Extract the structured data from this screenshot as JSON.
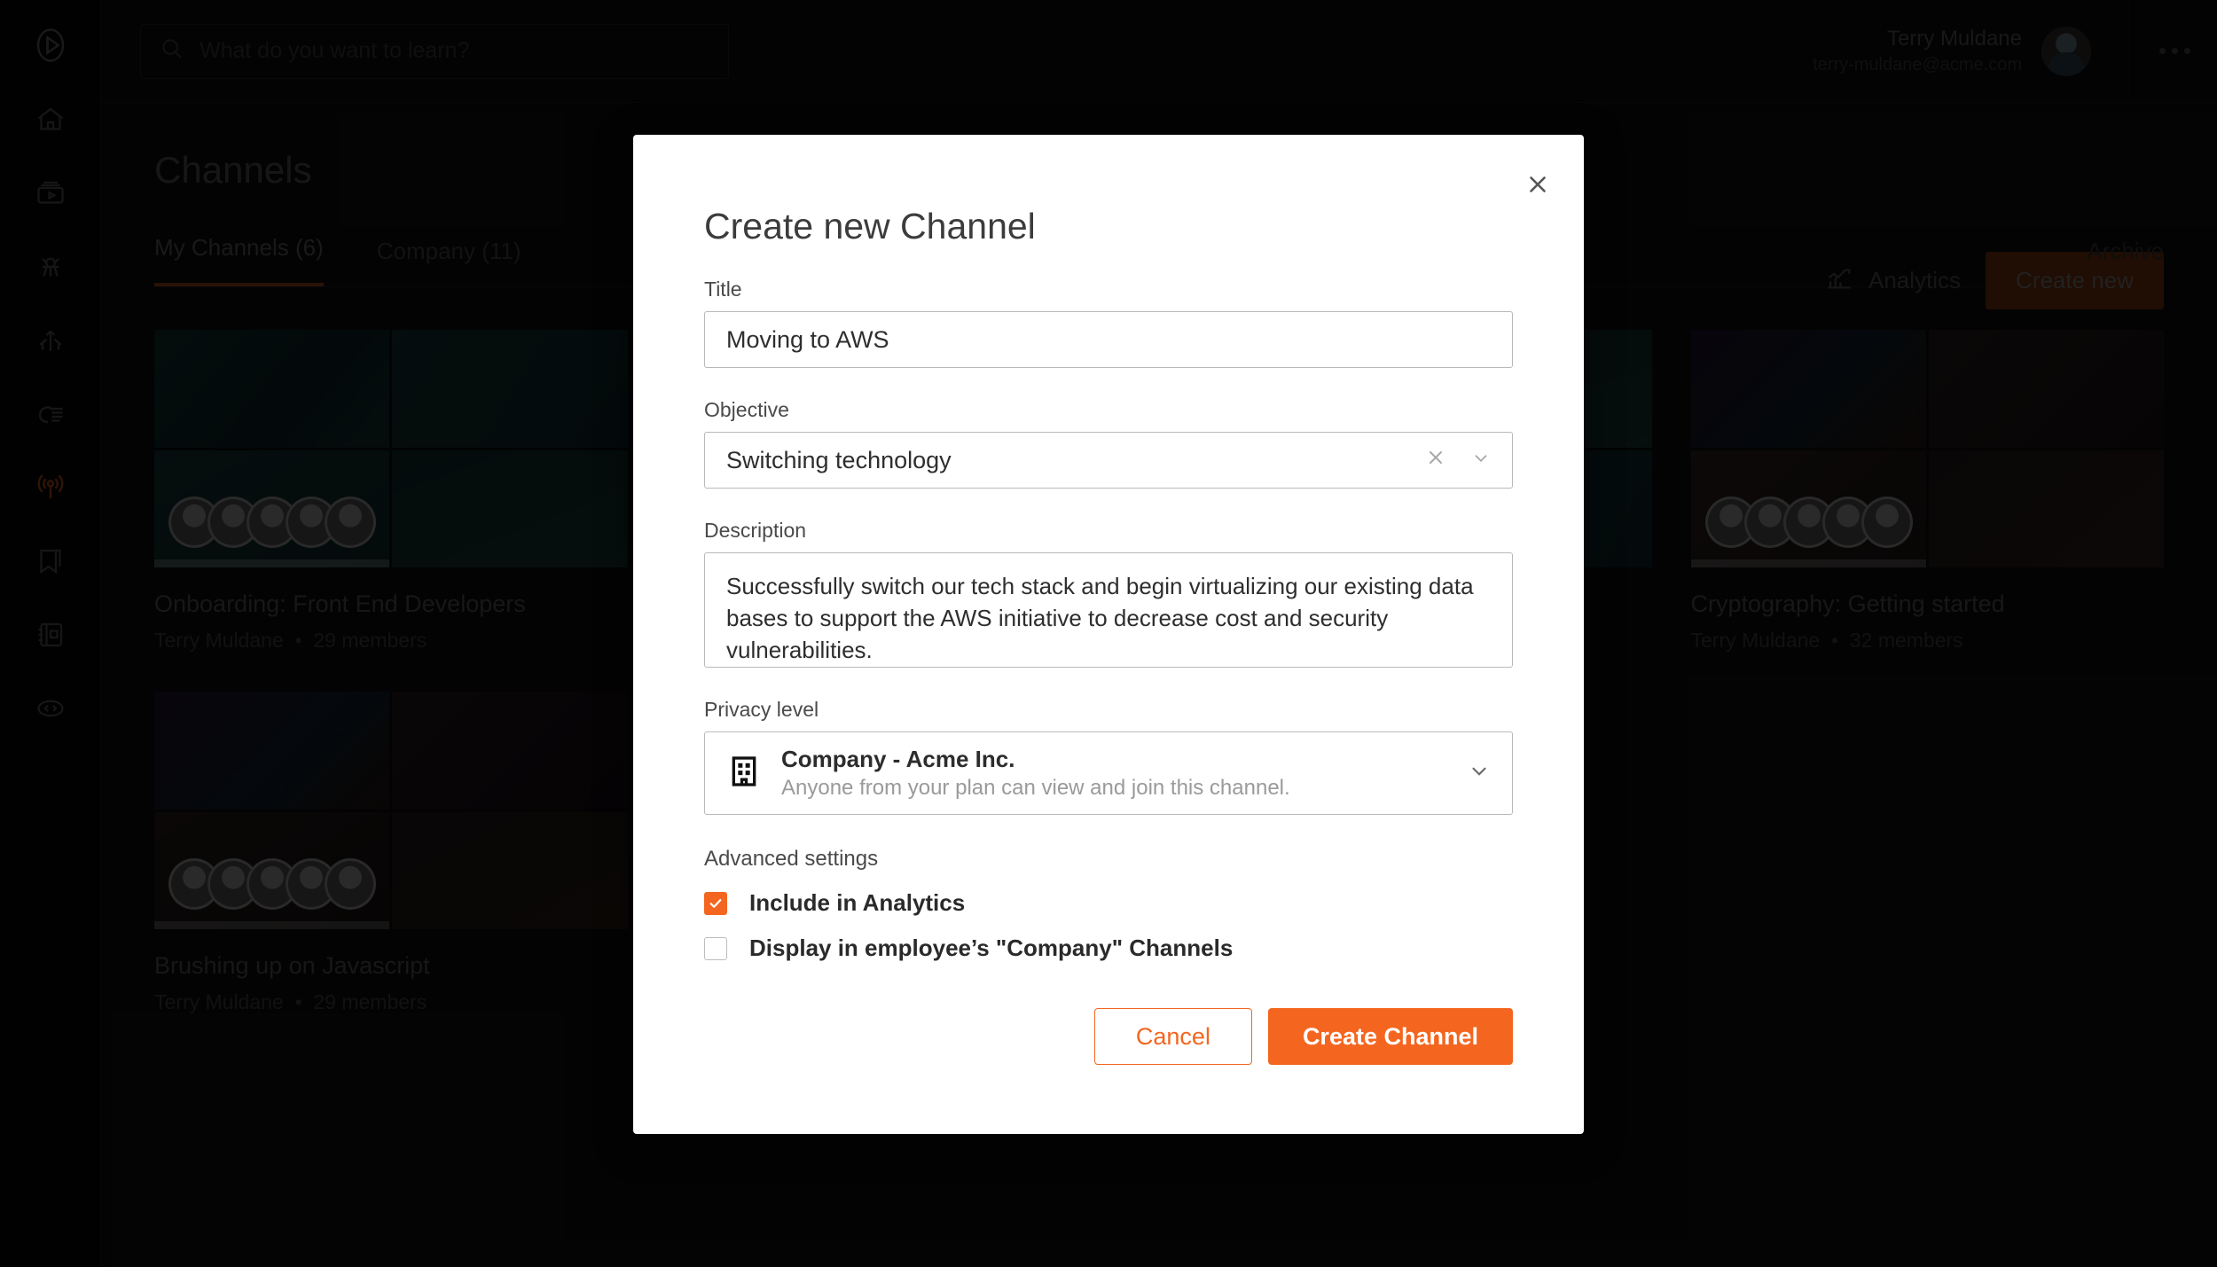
{
  "accent": {
    "orange": "#f4661f",
    "orange_dim": "#6b2d0d",
    "tab_underline": "#8c3f14"
  },
  "topbar": {
    "logo_icon": "play-logo-icon",
    "search": {
      "icon": "search-icon",
      "placeholder": "What do you want to learn?",
      "value": ""
    },
    "user": {
      "name": "Terry Muldane",
      "email": "terry-muldane@acme.com",
      "avatar_icon": "avatar"
    },
    "overflow_icon": "more-horizontal-icon"
  },
  "sidebar": {
    "items": [
      {
        "icon": "home-icon",
        "active": false
      },
      {
        "icon": "video-library-icon",
        "active": false
      },
      {
        "icon": "projector-icon",
        "active": false
      },
      {
        "icon": "paths-icon",
        "active": false
      },
      {
        "icon": "hand-swipe-icon",
        "active": false
      },
      {
        "icon": "broadcast-icon",
        "active": true
      },
      {
        "icon": "bookmark-icon",
        "active": false
      },
      {
        "icon": "notebook-icon",
        "active": false
      },
      {
        "icon": "code-icon",
        "active": false
      }
    ]
  },
  "page": {
    "title": "Channels",
    "tabs": [
      {
        "label": "My Channels (6)",
        "active": true
      },
      {
        "label": "Company (11)",
        "active": false
      }
    ],
    "archive_label": "Archive",
    "analytics_label": "Analytics",
    "analytics_icon": "analytics-chart-icon",
    "create_new_label": "Create new"
  },
  "channels": [
    {
      "title": "Onboarding: Front End Developers",
      "author": "Terry Muldane",
      "members": "29 members",
      "separator": "•"
    },
    {
      "title": "",
      "author": "",
      "members": "",
      "separator": ""
    },
    {
      "title": "",
      "author": "",
      "members": "",
      "separator": ""
    },
    {
      "title": "Cryptography: Getting started",
      "author": "Terry Muldane",
      "members": "32 members",
      "separator": "•"
    },
    {
      "title": "Brushing up on Javascript",
      "author": "Terry Muldane",
      "members": "29 members",
      "separator": "•"
    }
  ],
  "modal": {
    "title": "Create new Channel",
    "close_icon": "close-icon",
    "title_field": {
      "label": "Title",
      "value": "Moving to AWS",
      "placeholder": ""
    },
    "objective_field": {
      "label": "Objective",
      "value": "Switching technology",
      "clear_icon": "close-icon",
      "chevron_icon": "chevron-down-icon"
    },
    "description_field": {
      "label": "Description",
      "value": "Successfully switch our tech stack and begin virtualizing our existing data bases to support the AWS initiative to decrease cost and security vulnerabilities.",
      "placeholder": ""
    },
    "privacy_field": {
      "label": "Privacy level",
      "icon": "building-icon",
      "name": "Company - Acme Inc.",
      "description": "Anyone from your plan can view and join this channel.",
      "chevron_icon": "chevron-down-icon"
    },
    "advanced": {
      "label": "Advanced settings",
      "options": [
        {
          "label": "Include in Analytics",
          "checked": true
        },
        {
          "label": "Display in employee’s \"Company\" Channels",
          "checked": false
        }
      ]
    },
    "cancel_label": "Cancel",
    "submit_label": "Create Channel"
  }
}
